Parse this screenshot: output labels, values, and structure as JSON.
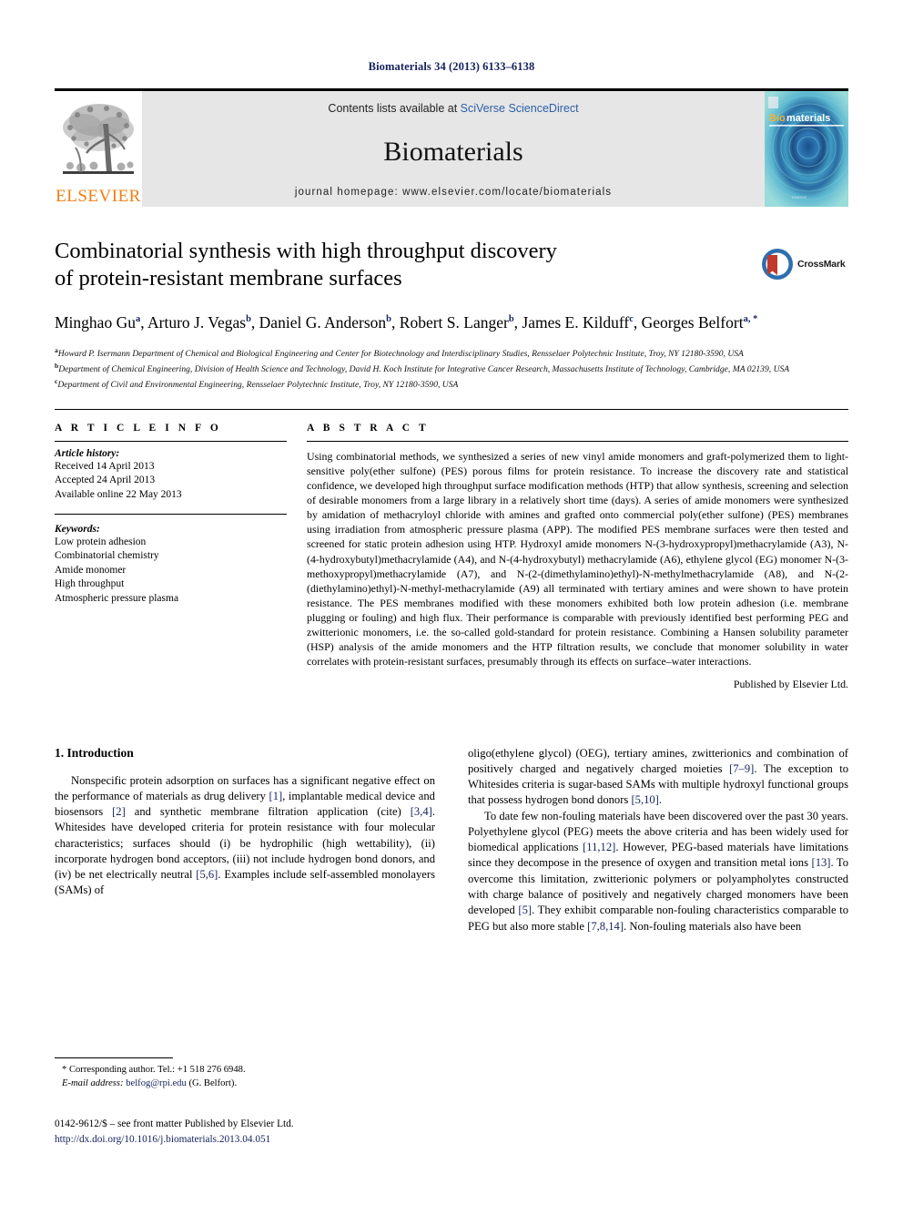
{
  "running_head": "Biomaterials 34 (2013) 6133–6138",
  "masthead": {
    "publisher_name": "ELSEVIER",
    "contents_prefix": "Contents lists available at ",
    "contents_link": "SciVerse ScienceDirect",
    "journal_title": "Biomaterials",
    "homepage": "journal homepage: www.elsevier.com/locate/biomaterials",
    "cover_title_bio": "Bio",
    "cover_title_materials": "materials"
  },
  "crossmark": {
    "label": "CrossMark"
  },
  "article": {
    "title_line1": "Combinatorial synthesis with high throughput discovery",
    "title_line2": "of protein-resistant membrane surfaces",
    "authors": [
      {
        "name": "Minghao Gu",
        "sup": "a",
        "sep": ", "
      },
      {
        "name": "Arturo J. Vegas",
        "sup": "b",
        "sep": ", "
      },
      {
        "name": "Daniel G. Anderson",
        "sup": "b",
        "sep": ", "
      },
      {
        "name": "Robert S. Langer",
        "sup": "b",
        "sep": ", "
      },
      {
        "name": "James E. Kilduff",
        "sup": "c",
        "sep": ", "
      },
      {
        "name": "Georges Belfort",
        "sup": "a, *",
        "sep": ""
      }
    ],
    "affiliations": [
      {
        "marker": "a",
        "text": "Howard P. Isermann Department of Chemical and Biological Engineering and Center for Biotechnology and Interdisciplinary Studies, Rensselaer Polytechnic Institute, Troy, NY 12180-3590, USA"
      },
      {
        "marker": "b",
        "text": "Department of Chemical Engineering, Division of Health Science and Technology, David H. Koch Institute for Integrative Cancer Research, Massachusetts Institute of Technology, Cambridge, MA 02139, USA"
      },
      {
        "marker": "c",
        "text": "Department of Civil and Environmental Engineering, Rensselaer Polytechnic Institute, Troy, NY 12180-3590, USA"
      }
    ]
  },
  "article_info": {
    "heading": "A R T I C L E   I N F O",
    "history_label": "Article history:",
    "history": [
      "Received 14 April 2013",
      "Accepted 24 April 2013",
      "Available online 22 May 2013"
    ],
    "keywords_label": "Keywords:",
    "keywords": [
      "Low protein adhesion",
      "Combinatorial chemistry",
      "Amide monomer",
      "High throughput",
      "Atmospheric pressure plasma"
    ]
  },
  "abstract": {
    "heading": "A B S T R A C T",
    "text": "Using combinatorial methods, we synthesized a series of new vinyl amide monomers and graft-polymerized them to light-sensitive poly(ether sulfone) (PES) porous films for protein resistance. To increase the discovery rate and statistical confidence, we developed high throughput surface modification methods (HTP) that allow synthesis, screening and selection of desirable monomers from a large library in a relatively short time (days). A series of amide monomers were synthesized by amidation of methacryloyl chloride with amines and grafted onto commercial poly(ether sulfone) (PES) membranes using irradiation from atmospheric pressure plasma (APP). The modified PES membrane surfaces were then tested and screened for static protein adhesion using HTP. Hydroxyl amide monomers N-(3-hydroxypropyl)methacrylamide (A3), N-(4-hydroxybutyl)methacrylamide (A4), and N-(4-hydroxybutyl) methacrylamide (A6), ethylene glycol (EG) monomer N-(3-methoxypropyl)methacrylamide (A7), and N-(2-(dimethylamino)ethyl)-N-methylmethacrylamide (A8), and N-(2-(diethylamino)ethyl)-N-methyl-methacrylamide (A9) all terminated with tertiary amines and were shown to have protein resistance. The PES membranes modified with these monomers exhibited both low protein adhesion (i.e. membrane plugging or fouling) and high flux. Their performance is comparable with previously identified best performing PEG and zwitterionic monomers, i.e. the so-called gold-standard for protein resistance. Combining a Hansen solubility parameter (HSP) analysis of the amide monomers and the HTP filtration results, we conclude that monomer solubility in water correlates with protein-resistant surfaces, presumably through its effects on surface–water interactions.",
    "published_by": "Published by Elsevier Ltd."
  },
  "introduction": {
    "heading": "1. Introduction",
    "left_paragraph_1_parts": [
      {
        "t": "Nonspecific protein adsorption on surfaces has a significant negative effect on the performance of materials as drug delivery ",
        "ref": false
      },
      {
        "t": "[1]",
        "ref": true
      },
      {
        "t": ", implantable medical device and biosensors ",
        "ref": false
      },
      {
        "t": "[2]",
        "ref": true
      },
      {
        "t": " and synthetic membrane filtration application (cite) ",
        "ref": false
      },
      {
        "t": "[3,4]",
        "ref": true
      },
      {
        "t": ". Whitesides have developed criteria for protein resistance with four molecular characteristics; surfaces should (i) be hydrophilic (high wettability), (ii) incorporate hydrogen bond acceptors, (iii) not include hydrogen bond donors, and (iv) be net electrically neutral ",
        "ref": false
      },
      {
        "t": "[5,6]",
        "ref": true
      },
      {
        "t": ". Examples include self-assembled monolayers (SAMs) of",
        "ref": false
      }
    ],
    "right_paragraph_1_parts": [
      {
        "t": "oligo(ethylene glycol) (OEG), tertiary amines, zwitterionics and combination of positively charged and negatively charged moieties ",
        "ref": false
      },
      {
        "t": "[7–9]",
        "ref": true
      },
      {
        "t": ". The exception to Whitesides criteria is sugar-based SAMs with multiple hydroxyl functional groups that possess hydrogen bond donors ",
        "ref": false
      },
      {
        "t": "[5,10]",
        "ref": true
      },
      {
        "t": ".",
        "ref": false
      }
    ],
    "right_paragraph_2_parts": [
      {
        "t": "To date few non-fouling materials have been discovered over the past 30 years. Polyethylene glycol (PEG) meets the above criteria and has been widely used for biomedical applications ",
        "ref": false
      },
      {
        "t": "[11,12]",
        "ref": true
      },
      {
        "t": ". However, PEG-based materials have limitations since they decompose in the presence of oxygen and transition metal ions ",
        "ref": false
      },
      {
        "t": "[13]",
        "ref": true
      },
      {
        "t": ". To overcome this limitation, zwitterionic polymers or polyampholytes constructed with charge balance of positively and negatively charged monomers have been developed ",
        "ref": false
      },
      {
        "t": "[5]",
        "ref": true
      },
      {
        "t": ". They exhibit comparable non-fouling characteristics comparable to PEG but also more stable ",
        "ref": false
      },
      {
        "t": "[7,8,14]",
        "ref": true
      },
      {
        "t": ". Non-fouling materials also have been",
        "ref": false
      }
    ]
  },
  "footnote": {
    "corresponding": "* Corresponding author. Tel.: +1 518 276 6948.",
    "email_label": "E-mail address:",
    "email": "belfog@rpi.edu",
    "email_suffix": "(G. Belfort)."
  },
  "footer": {
    "copyright": "0142-9612/$ – see front matter Published by Elsevier Ltd.",
    "doi": "http://dx.doi.org/10.1016/j.biomaterials.2013.04.051"
  },
  "colors": {
    "link_blue": "#2b5fa8",
    "ref_blue": "#14215c",
    "elsevier_orange": "#f07f13",
    "masthead_gray": "#e6e6e6"
  }
}
